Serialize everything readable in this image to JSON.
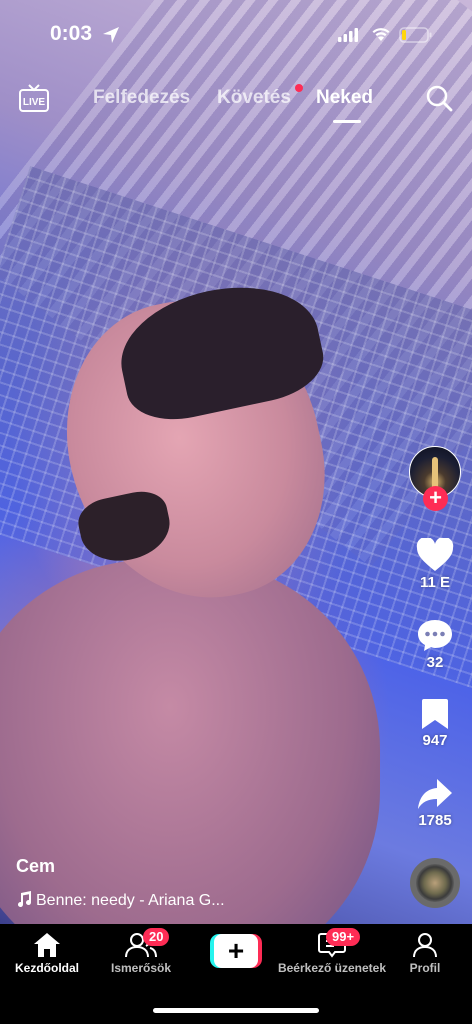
{
  "status_bar": {
    "time": "0:03",
    "icons": [
      "location-arrow-icon",
      "signal-icon",
      "wifi-icon",
      "battery-icon"
    ]
  },
  "top_nav": {
    "live_label": "LIVE",
    "tabs": [
      {
        "label": "Felfedezés",
        "active": false
      },
      {
        "label": "Követés",
        "active": false,
        "has_dot": true
      },
      {
        "label": "Neked",
        "active": true
      }
    ]
  },
  "video": {
    "username": "Cem",
    "music": "Benne: needy - Ariana G..."
  },
  "actions": {
    "likes": "11 E",
    "comments": "32",
    "bookmarks": "947",
    "shares": "1785"
  },
  "bottom_nav": {
    "items": [
      {
        "label": "Kezdőoldal",
        "active": true
      },
      {
        "label": "Ismerősök",
        "badge": "20"
      },
      {
        "label": "Beérkező üzenetek",
        "badge": "99+"
      },
      {
        "label": "Profil"
      }
    ],
    "create_label": "+"
  },
  "colors": {
    "accent": "#fe2c55",
    "cyan": "#25f4ee",
    "background": "#000000"
  }
}
